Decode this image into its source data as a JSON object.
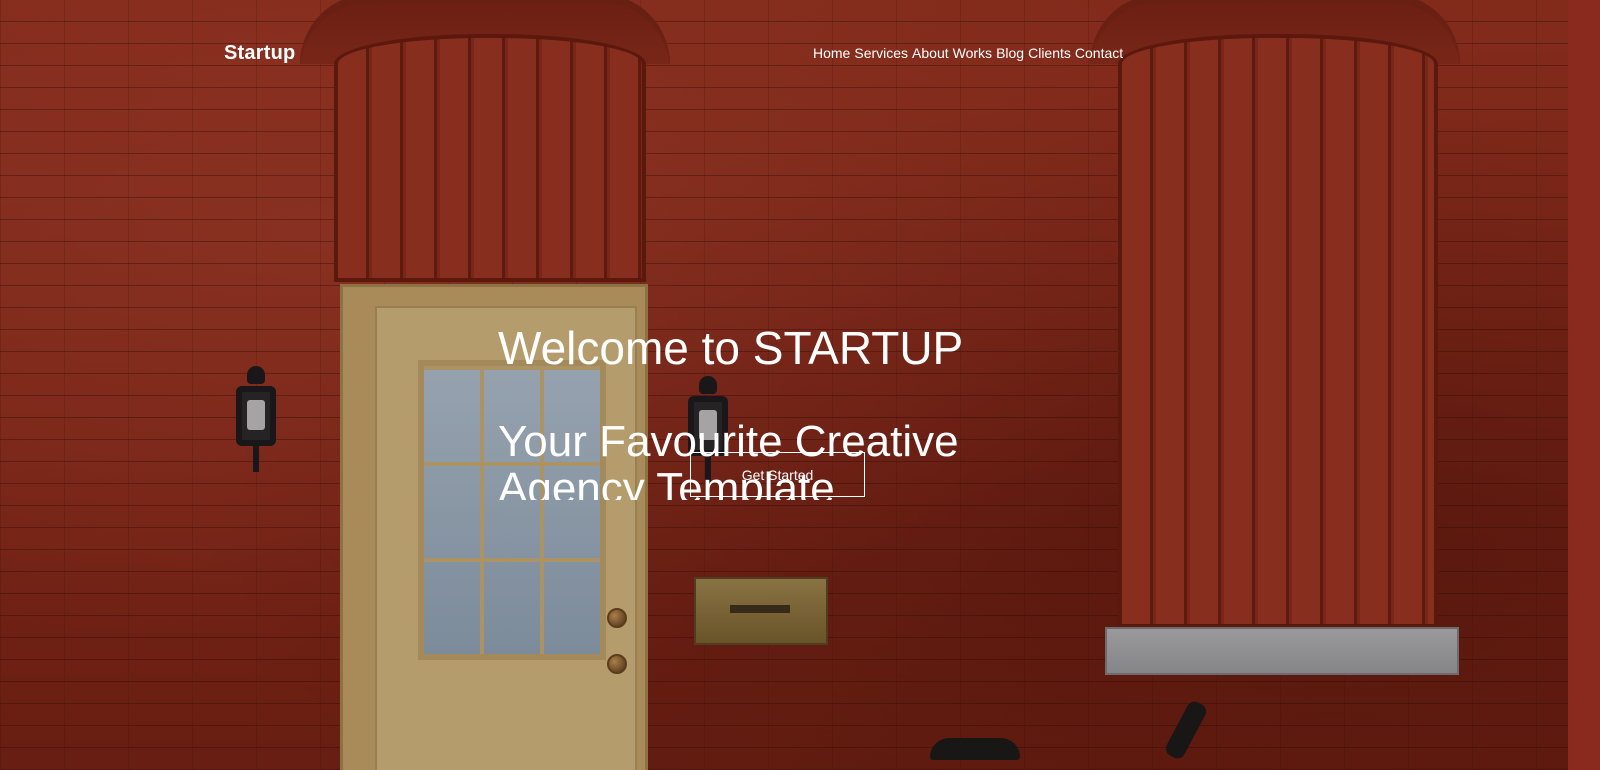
{
  "brand": {
    "name": "Startup"
  },
  "nav": {
    "items": [
      {
        "label": "Home"
      },
      {
        "label": "Services"
      },
      {
        "label": "About"
      },
      {
        "label": "Works"
      },
      {
        "label": "Blog"
      },
      {
        "label": "Clients"
      },
      {
        "label": "Contact"
      }
    ]
  },
  "hero": {
    "title": "Welcome to STARTUP",
    "subtitle": "Your Favourite Creative Agency Template",
    "cta_label": "Get Started",
    "background_image": "red brick storefront with a cream door, shuttered window, wall lamps and a mailbox"
  },
  "colors": {
    "text": "#ffffff",
    "brick": "#93301f",
    "door": "#d7bd84"
  }
}
